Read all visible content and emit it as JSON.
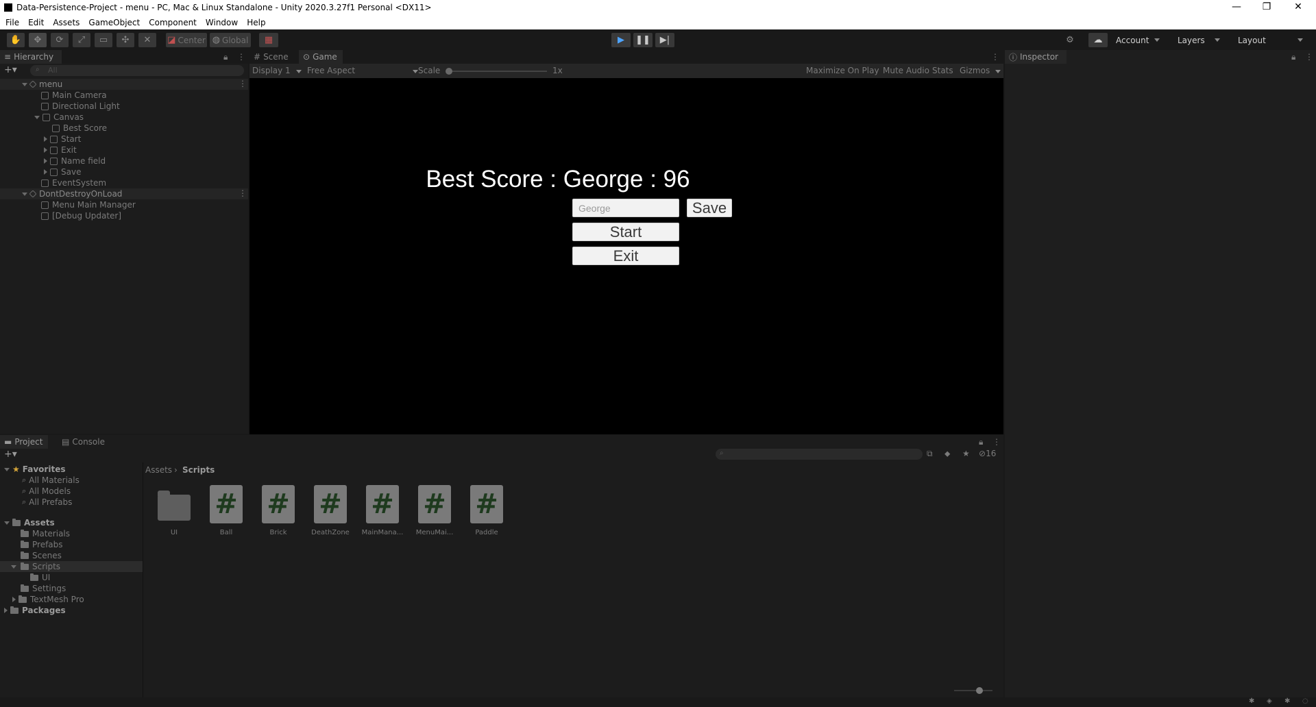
{
  "window": {
    "title": "Data-Persistence-Project - menu - PC, Mac & Linux Standalone - Unity 2020.3.27f1 Personal <DX11>",
    "controls": [
      "—",
      "❐",
      "✕"
    ]
  },
  "menu": [
    "File",
    "Edit",
    "Assets",
    "GameObject",
    "Component",
    "Window",
    "Help"
  ],
  "toolbar": {
    "pivot_label": "Center",
    "space_label": "Global",
    "account_label": "Account",
    "layers_label": "Layers",
    "layout_label": "Layout"
  },
  "hierarchy": {
    "tab": "Hierarchy",
    "search_placeholder": "All",
    "rows": [
      {
        "label": "menu",
        "kind": "scene"
      },
      {
        "label": "Main Camera",
        "kind": "obj"
      },
      {
        "label": "Directional Light",
        "kind": "obj"
      },
      {
        "label": "Canvas",
        "kind": "parent"
      },
      {
        "label": "Best Score",
        "kind": "child"
      },
      {
        "label": "Start",
        "kind": "childp"
      },
      {
        "label": "Exit",
        "kind": "childp"
      },
      {
        "label": "Name field",
        "kind": "childp"
      },
      {
        "label": "Save",
        "kind": "childp"
      },
      {
        "label": "EventSystem",
        "kind": "obj"
      },
      {
        "label": "DontDestroyOnLoad",
        "kind": "scene"
      },
      {
        "label": "Menu Main Manager",
        "kind": "obj"
      },
      {
        "label": "[Debug Updater]",
        "kind": "obj"
      }
    ]
  },
  "view_tabs": {
    "scene": "Scene",
    "game": "Game"
  },
  "game_toolbar": {
    "display": "Display 1",
    "aspect": "Free Aspect",
    "scale_label": "Scale",
    "scale_value": "1x",
    "maximize": "Maximize On Play",
    "mute": "Mute Audio",
    "stats": "Stats",
    "gizmos": "Gizmos"
  },
  "game": {
    "best_score": "Best Score : George : 96",
    "name_placeholder": "George",
    "save": "Save",
    "start": "Start",
    "exit": "Exit"
  },
  "inspector": {
    "tab": "Inspector"
  },
  "project": {
    "tab_project": "Project",
    "tab_console": "Console",
    "breadcrumb_root": "Assets",
    "breadcrumb_current": "Scripts",
    "hidden_count": "16",
    "favorites": {
      "label": "Favorites",
      "items": [
        "All Materials",
        "All Models",
        "All Prefabs"
      ]
    },
    "tree": [
      {
        "label": "Assets",
        "level": 0,
        "bold": true
      },
      {
        "label": "Materials",
        "level": 1
      },
      {
        "label": "Prefabs",
        "level": 1
      },
      {
        "label": "Scenes",
        "level": 1
      },
      {
        "label": "Scripts",
        "level": 1,
        "selected": true
      },
      {
        "label": "UI",
        "level": 2
      },
      {
        "label": "Settings",
        "level": 1
      },
      {
        "label": "TextMesh Pro",
        "level": 1
      },
      {
        "label": "Packages",
        "level": 0,
        "bold": true
      }
    ],
    "assets": [
      {
        "label": "UI",
        "type": "folder"
      },
      {
        "label": "Ball",
        "type": "script"
      },
      {
        "label": "Brick",
        "type": "script"
      },
      {
        "label": "DeathZone",
        "type": "script"
      },
      {
        "label": "MainMana...",
        "type": "script"
      },
      {
        "label": "MenuMai...",
        "type": "script"
      },
      {
        "label": "Paddle",
        "type": "script"
      }
    ]
  },
  "colors": {
    "accent_green_hash": "#1e3a1e",
    "panel_bg": "#1c1c1c",
    "game_bg": "#000000"
  }
}
